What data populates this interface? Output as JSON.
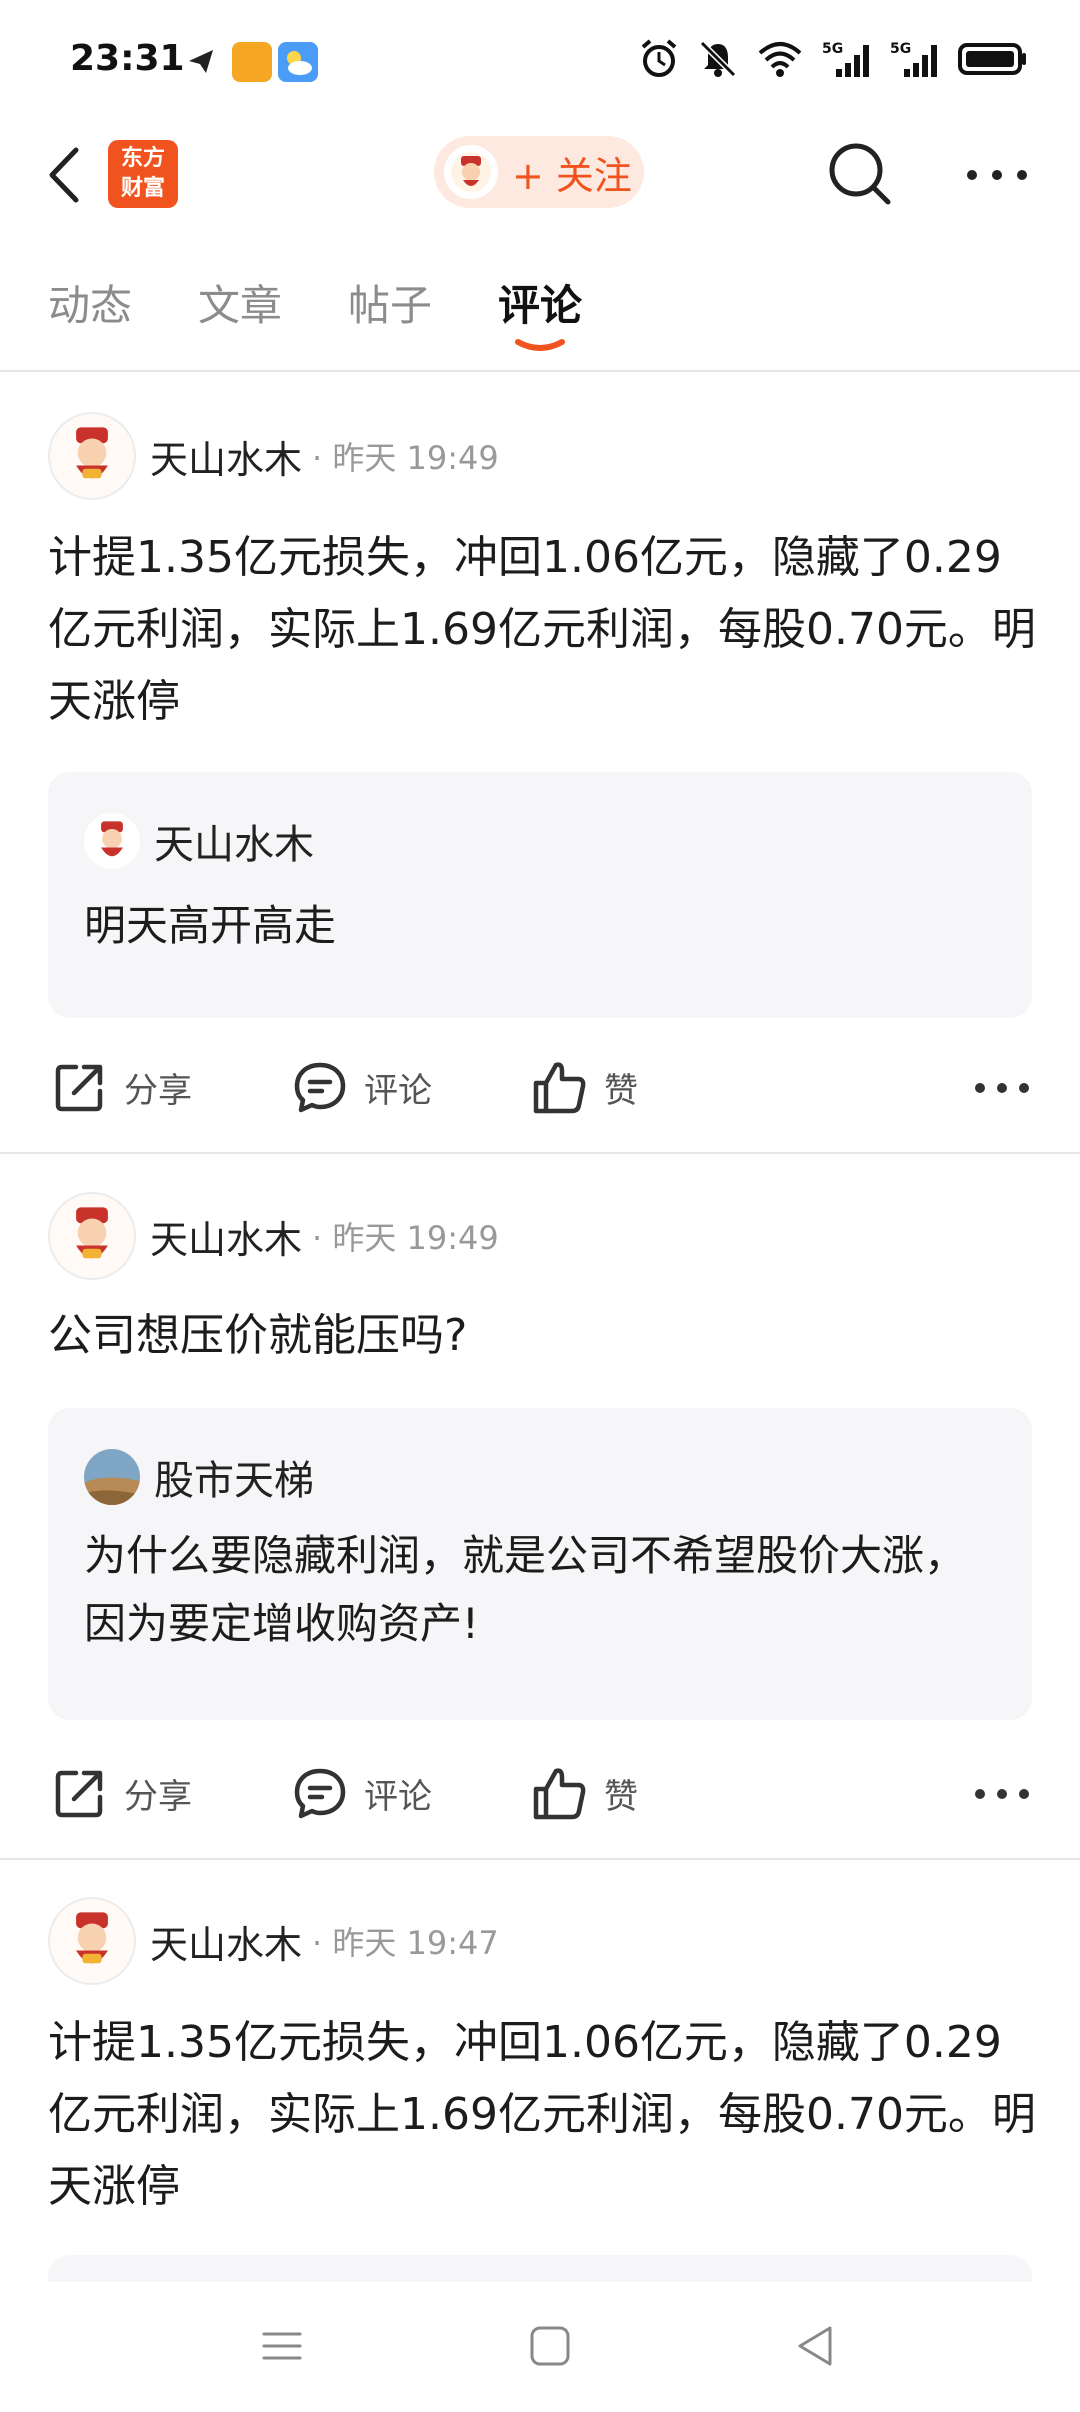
{
  "status_bar": {
    "time": "23:31",
    "notification_icons": [
      "paper-plane-icon",
      "app-badge-icon",
      "weather-icon"
    ],
    "system_icons": [
      "alarm-icon",
      "mute-icon",
      "wifi-icon",
      "signal-5g-icon",
      "signal-5g-icon",
      "battery-icon"
    ]
  },
  "header": {
    "brand_line1": "东方",
    "brand_line2": "财富",
    "follow_label": "+ 关注"
  },
  "tabs": [
    {
      "label": "动态",
      "active": false
    },
    {
      "label": "文章",
      "active": false
    },
    {
      "label": "帖子",
      "active": false
    },
    {
      "label": "评论",
      "active": true
    }
  ],
  "accent_color": "#f0531e",
  "posts": [
    {
      "author": "天山水木",
      "meta": "· 昨天 19:49",
      "body": "计提1.35亿元损失，冲回1.06亿元，隐藏了0.29亿元利润，实际上1.69亿元利润，每股0.70元。明天涨停",
      "quote_author": "天山水木",
      "quote_text": "明天高开高走"
    },
    {
      "author": "天山水木",
      "meta": "· 昨天 19:49",
      "body": "公司想压价就能压吗?",
      "quote_author": "股市天梯",
      "quote_text": "为什么要隐藏利润，就是公司不希望股价大涨，因为要定增收购资产!"
    },
    {
      "author": "天山水木",
      "meta": "· 昨天 19:47",
      "body": "计提1.35亿元损失，冲回1.06亿元，隐藏了0.29亿元利润，实际上1.69亿元利润，每股0.70元。明天涨停"
    }
  ],
  "actions": {
    "share": "分享",
    "comment": "评论",
    "like": "赞"
  }
}
